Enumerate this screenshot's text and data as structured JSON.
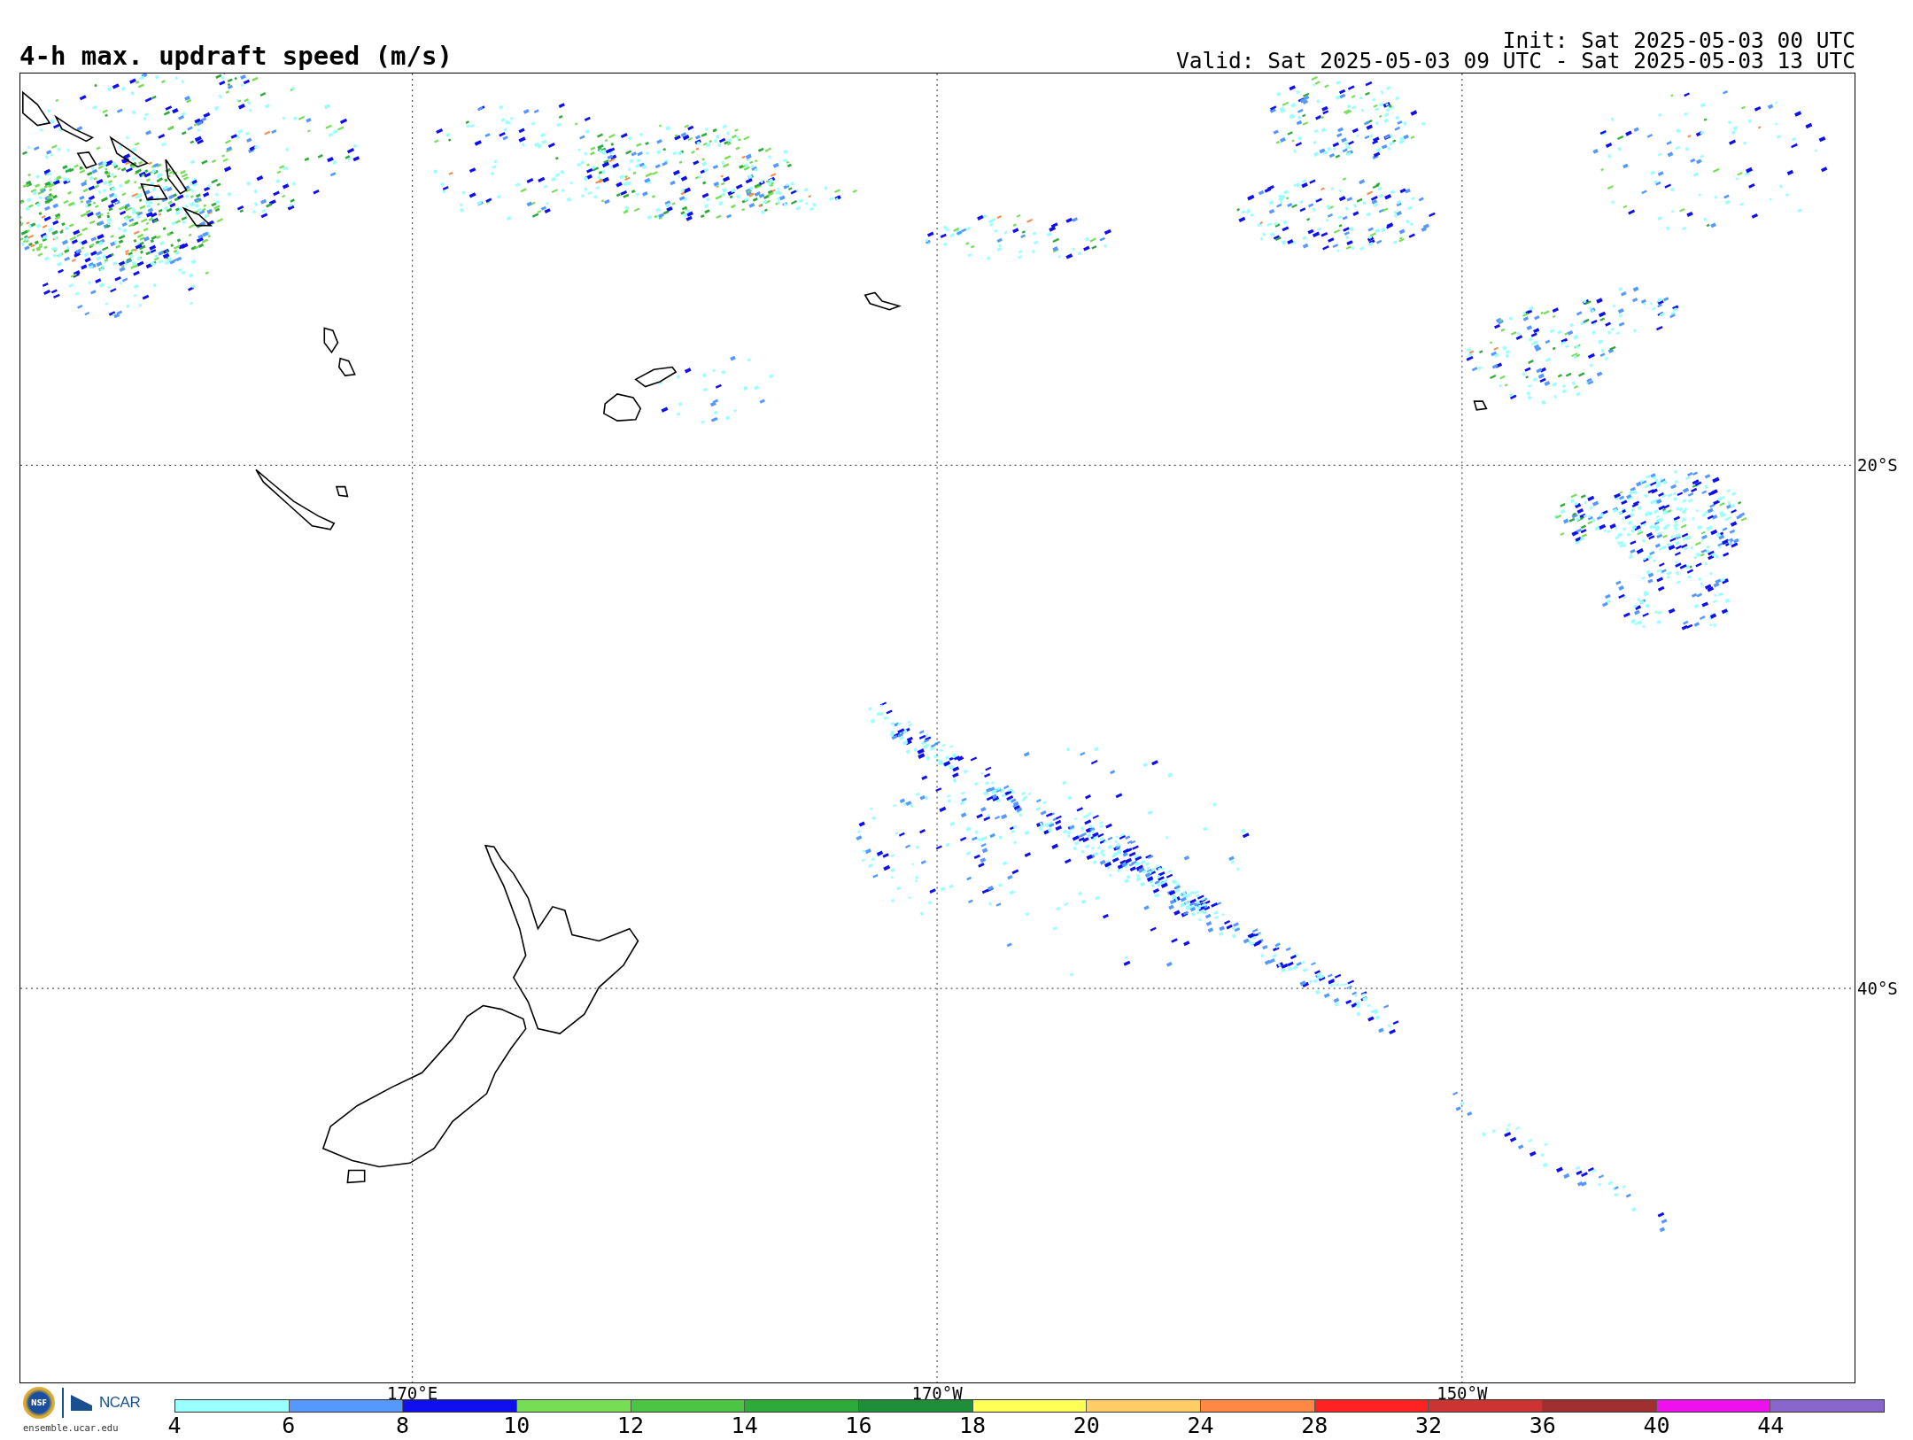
{
  "title": "4-h max. updraft speed (m/s)",
  "init": "Init: Sat 2025-05-03 00 UTC",
  "valid": "Valid: Sat 2025-05-03 09 UTC - Sat 2025-05-03 13 UTC",
  "map": {
    "longitude_labels": [
      "170°E",
      "170°W",
      "150°W"
    ],
    "latitude_labels": [
      "20°S",
      "40°S"
    ]
  },
  "logo": {
    "emblem": "NSF",
    "name": "NCAR",
    "url": "ensemble.ucar.edu"
  },
  "colorbar": {
    "ticks": [
      "4",
      "6",
      "8",
      "10",
      "12",
      "14",
      "16",
      "18",
      "20",
      "24",
      "28",
      "32",
      "36",
      "40",
      "44"
    ],
    "bins": [
      {
        "color": "#99ffff"
      },
      {
        "color": "#5599ff"
      },
      {
        "color": "#1010ee"
      },
      {
        "color": "#77dd55"
      },
      {
        "color": "#4cc444"
      },
      {
        "color": "#2eaa3a"
      },
      {
        "color": "#1e8e3a"
      },
      {
        "color": "#ffff55"
      },
      {
        "color": "#ffcc66"
      },
      {
        "color": "#ff8844"
      },
      {
        "color": "#ff2222"
      },
      {
        "color": "#cc3333"
      },
      {
        "color": "#a03030"
      },
      {
        "color": "#ee11ee"
      },
      {
        "color": "#8866cc"
      }
    ]
  }
}
